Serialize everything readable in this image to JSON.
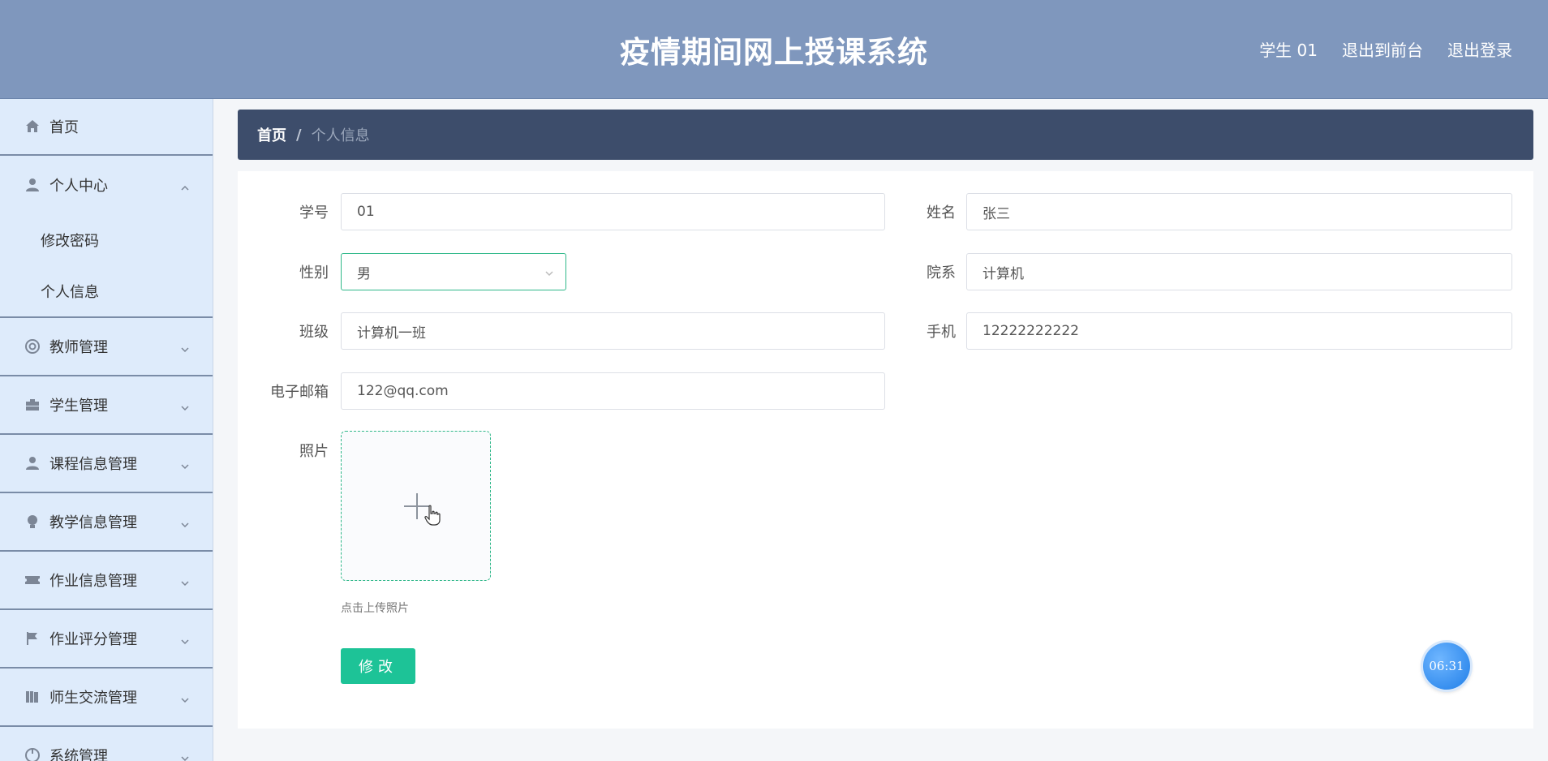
{
  "header": {
    "title": "疫情期间网上授课系统",
    "user": "学生 01",
    "exit_front": "退出到前台",
    "logout": "退出登录"
  },
  "sidebar": {
    "home": "首页",
    "personal_center": "个人中心",
    "personal_sub": [
      "修改密码",
      "个人信息"
    ],
    "items": [
      "教师管理",
      "学生管理",
      "课程信息管理",
      "教学信息管理",
      "作业信息管理",
      "作业评分管理",
      "师生交流管理",
      "系统管理"
    ]
  },
  "breadcrumb": {
    "home": "首页",
    "separator": "/",
    "current": "个人信息"
  },
  "form": {
    "student_id": {
      "label": "学号",
      "value": "01"
    },
    "name": {
      "label": "姓名",
      "value": "张三"
    },
    "gender": {
      "label": "性别",
      "value": "男"
    },
    "department": {
      "label": "院系",
      "value": "计算机"
    },
    "class": {
      "label": "班级",
      "value": "计算机一班"
    },
    "phone": {
      "label": "手机",
      "value": "12222222222"
    },
    "email": {
      "label": "电子邮箱",
      "value": "122@qq.com"
    },
    "photo": {
      "label": "照片",
      "tip": "点击上传照片"
    },
    "submit": "修改"
  },
  "timer": "06:31",
  "colors": {
    "header_bg": "#7f97bd",
    "sidebar_bg": "#deebfb",
    "breadcrumb_bg": "#3d4d6b",
    "primary": "#1dc397",
    "select_border": "#2fb889"
  }
}
